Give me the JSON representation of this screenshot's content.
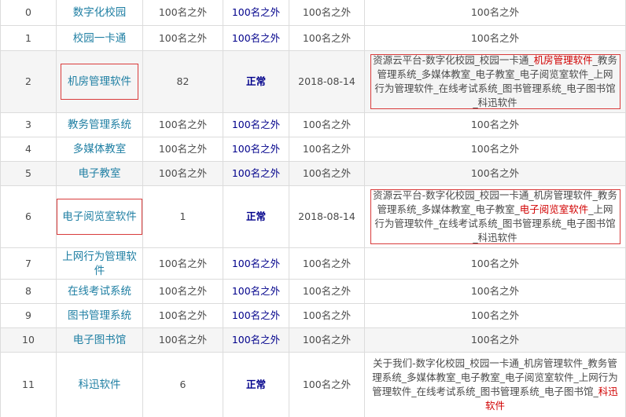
{
  "rows": [
    {
      "rank": "0",
      "keyword": "数字化校园",
      "baidu": "100名之外",
      "mobile": "100名之外",
      "date": "100名之外",
      "title": "100名之外"
    },
    {
      "rank": "1",
      "keyword": "校园一卡通",
      "baidu": "100名之外",
      "mobile": "100名之外",
      "date": "100名之外",
      "title": "100名之外"
    },
    {
      "rank": "2",
      "keyword": "机房管理软件",
      "baidu": "82",
      "mobile": "正常",
      "date": "2018-08-14",
      "title_pre": "资源云平台-数字化校园_校园一卡通_",
      "title_hl": "机房管理软件",
      "title_post": "_教务管理系统_多媒体教室_电子教室_电子阅览室软件_上网行为管理软件_在线考试系统_图书管理系统_电子图书馆_科迅软件"
    },
    {
      "rank": "3",
      "keyword": "教务管理系统",
      "baidu": "100名之外",
      "mobile": "100名之外",
      "date": "100名之外",
      "title": "100名之外"
    },
    {
      "rank": "4",
      "keyword": "多媒体教室",
      "baidu": "100名之外",
      "mobile": "100名之外",
      "date": "100名之外",
      "title": "100名之外"
    },
    {
      "rank": "5",
      "keyword": "电子教室",
      "baidu": "100名之外",
      "mobile": "100名之外",
      "date": "100名之外",
      "title": "100名之外"
    },
    {
      "rank": "6",
      "keyword": "电子阅览室软件",
      "baidu": "1",
      "mobile": "正常",
      "date": "2018-08-14",
      "title_pre": "资源云平台-数字化校园_校园一卡通_机房管理软件_教务管理系统_多媒体教室_电子教室_",
      "title_hl": "电子阅览室软件",
      "title_post": "_上网行为管理软件_在线考试系统_图书管理系统_电子图书馆_科迅软件"
    },
    {
      "rank": "7",
      "keyword": "上网行为管理软件",
      "baidu": "100名之外",
      "mobile": "100名之外",
      "date": "100名之外",
      "title": "100名之外"
    },
    {
      "rank": "8",
      "keyword": "在线考试系统",
      "baidu": "100名之外",
      "mobile": "100名之外",
      "date": "100名之外",
      "title": "100名之外"
    },
    {
      "rank": "9",
      "keyword": "图书管理系统",
      "baidu": "100名之外",
      "mobile": "100名之外",
      "date": "100名之外",
      "title": "100名之外"
    },
    {
      "rank": "10",
      "keyword": "电子图书馆",
      "baidu": "100名之外",
      "mobile": "100名之外",
      "date": "100名之外",
      "title": "100名之外"
    },
    {
      "rank": "11",
      "keyword": "科迅软件",
      "baidu": "6",
      "mobile": "正常",
      "date": "100名之外",
      "title_pre": "关于我们-数字化校园_校园一卡通_机房管理软件_教务管理系统_多媒体教室_电子教室_电子阅览室软件_上网行为管理软件_在线考试系统_图书管理系统_电子图书馆_",
      "title_hl": "科迅软件",
      "title_post": ""
    }
  ]
}
